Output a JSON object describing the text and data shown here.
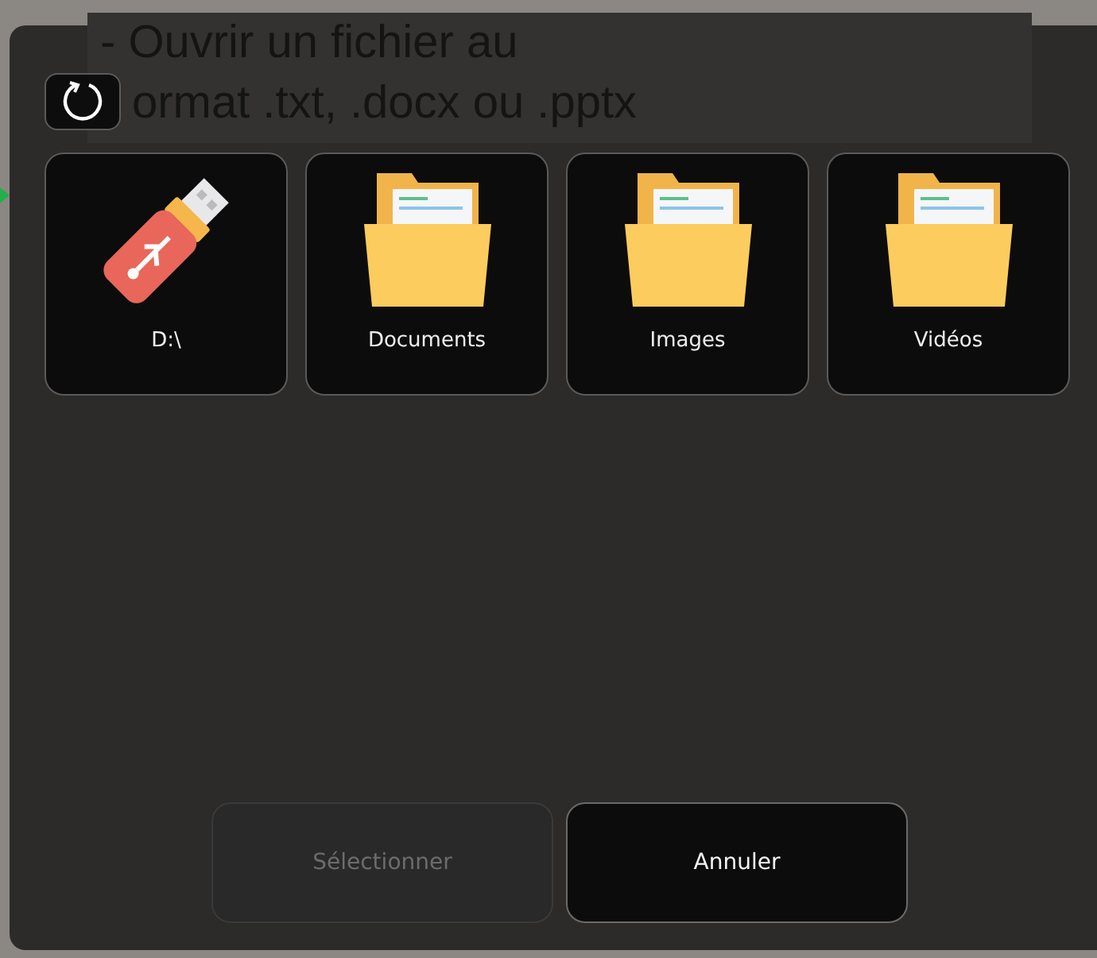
{
  "background_text": [
    "- Ouvrir un fichier au",
    "ormat .txt, .docx ou .pptx"
  ],
  "locations": [
    {
      "label": "D:\\",
      "kind": "drive"
    },
    {
      "label": "Documents",
      "kind": "folder"
    },
    {
      "label": "Images",
      "kind": "folder"
    },
    {
      "label": "Vidéos",
      "kind": "folder"
    }
  ],
  "buttons": [
    {
      "label": "Sélectionner",
      "disabled": true
    },
    {
      "label": "Annuler",
      "disabled": false
    }
  ]
}
